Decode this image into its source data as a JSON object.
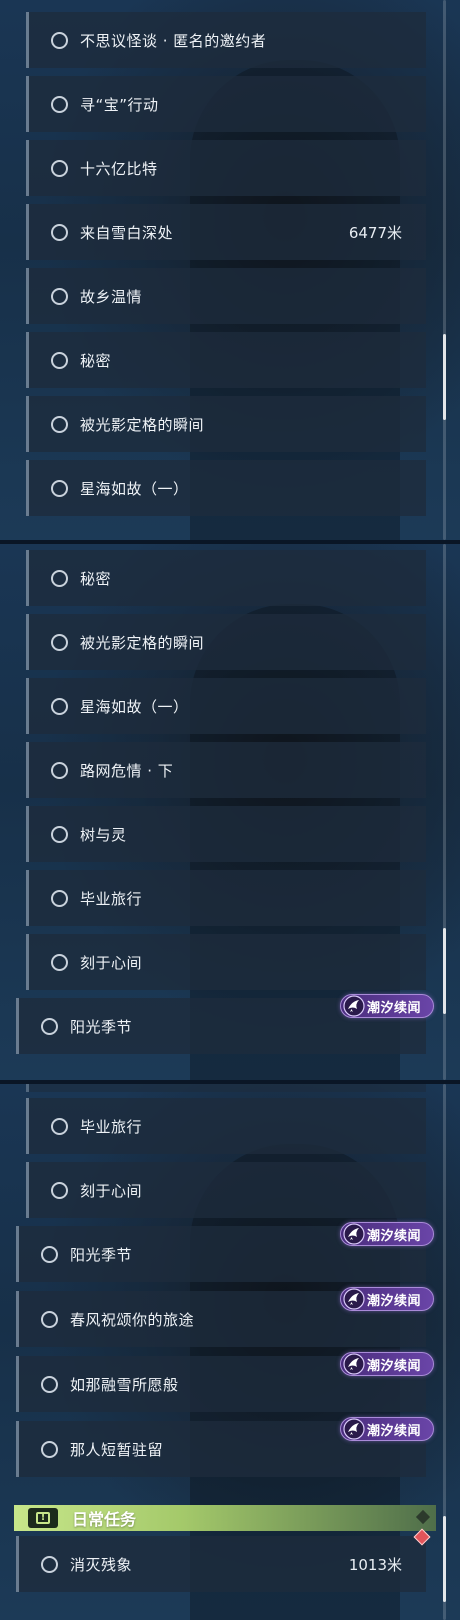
{
  "panel1": {
    "quests": [
      {
        "label": "不思议怪谈 · 匿名的邀约者"
      },
      {
        "label": "寻“宝”行动"
      },
      {
        "label": "十六亿比特"
      },
      {
        "label": "来自雪白深处",
        "distance": "6477米"
      },
      {
        "label": "故乡温情"
      },
      {
        "label": "秘密"
      },
      {
        "label": "被光影定格的瞬间"
      },
      {
        "label": "星海如故（一）"
      }
    ]
  },
  "panel2": {
    "quests": [
      {
        "label": "秘密"
      },
      {
        "label": "被光影定格的瞬间"
      },
      {
        "label": "星海如故（一）"
      },
      {
        "label": "路网危情 · 下"
      },
      {
        "label": "树与灵"
      },
      {
        "label": "毕业旅行"
      },
      {
        "label": "刻于心间"
      },
      {
        "label": "阳光季节",
        "badge": "潮汐续闻"
      }
    ]
  },
  "panel3": {
    "quests": [
      {
        "label": "毕业旅行"
      },
      {
        "label": "刻于心间"
      },
      {
        "label": "阳光季节",
        "badge": "潮汐续闻"
      },
      {
        "label": "春风祝颂你的旅途",
        "badge": "潮汐续闻"
      },
      {
        "label": "如那融雪所愿般",
        "badge": "潮汐续闻"
      },
      {
        "label": "那人短暂驻留",
        "badge": "潮汐续闻"
      }
    ],
    "daily_section": {
      "title": "日常任务",
      "quest": {
        "label": "消灭残象",
        "distance": "1013米"
      }
    }
  },
  "icons": {
    "quest_status": "circle-outline-icon",
    "badge_emblem": "tidal-emblem-icon",
    "daily_header": "exclamation-box-icon",
    "tracker": "red-diamond-icon"
  },
  "colors": {
    "badge_purple": "#6a45a8",
    "daily_green": "#c7e68a",
    "tracker_red": "#e2545a"
  }
}
